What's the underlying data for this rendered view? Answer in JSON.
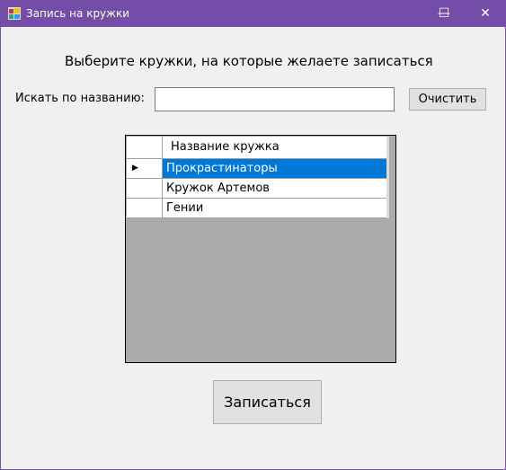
{
  "window": {
    "title": "Запись на кружки",
    "minimize_icon": "minimize-icon",
    "maximize_icon": "maximize-icon",
    "close_icon": "close-icon"
  },
  "heading": "Выберите кружки, на которые желаете записаться",
  "search": {
    "label": "Искать по названию:",
    "value": "",
    "placeholder": "",
    "clear_label": "Очистить"
  },
  "grid": {
    "column_header": "Название кружка",
    "rows": [
      "Прокрастинаторы",
      "Кружок Артемов",
      "Гении"
    ],
    "selected_index": 0
  },
  "submit_label": "Записаться",
  "colors": {
    "titlebar": "#744da9",
    "selection": "#0078d7",
    "grid_background": "#ababab"
  }
}
